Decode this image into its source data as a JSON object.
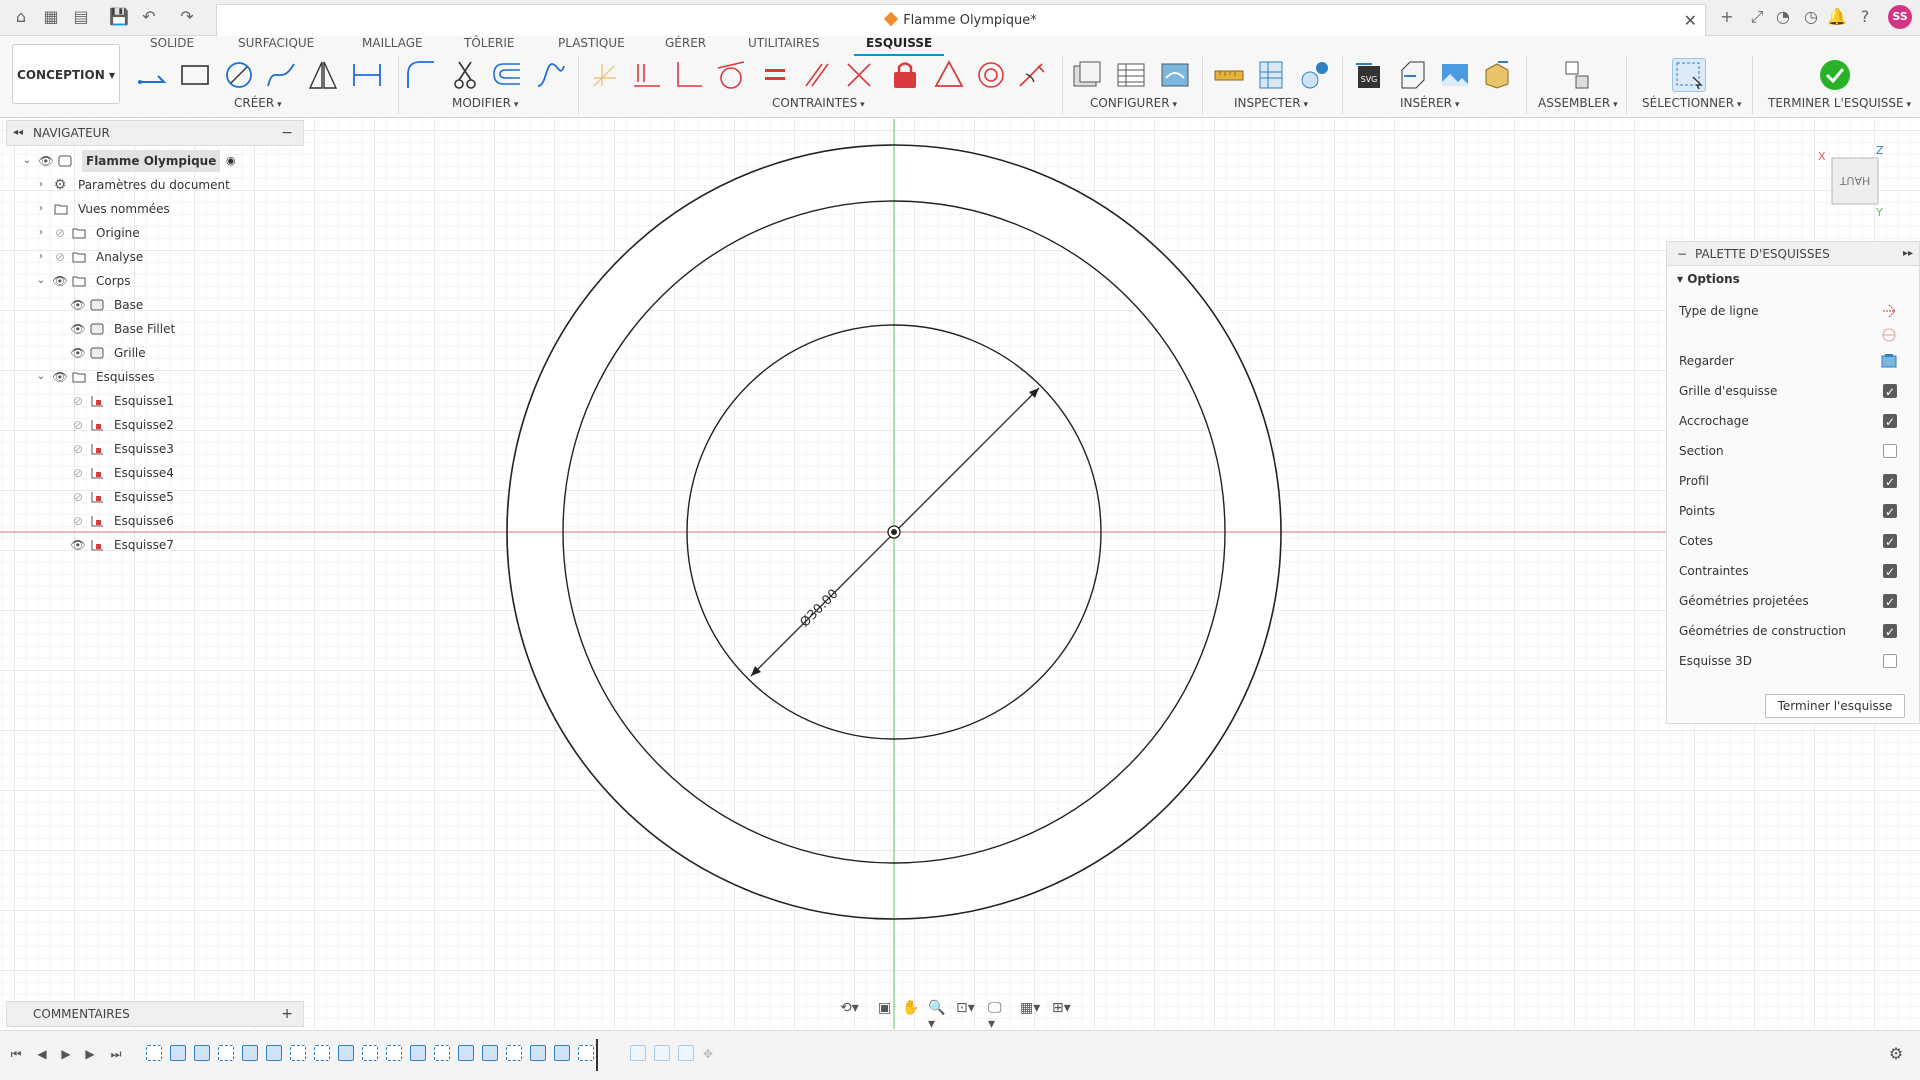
{
  "window": {
    "title": "Flamme Olympique*",
    "user_initials": "SS"
  },
  "ribbon": {
    "workspace": "CONCEPTION",
    "tabs": [
      "SOLIDE",
      "SURFACIQUE",
      "MAILLAGE",
      "TÔLERIE",
      "PLASTIQUE",
      "GÉRER",
      "UTILITAIRES",
      "ESQUISSE"
    ],
    "active_tab": "ESQUISSE",
    "groups": [
      "CRÉER",
      "MODIFIER",
      "CONTRAINTES",
      "CONFIGURER",
      "INSPECTER",
      "INSÉRER",
      "ASSEMBLER",
      "SÉLECTIONNER",
      "TERMINER L'ESQUISSE"
    ]
  },
  "navigator": {
    "title": "NAVIGATEUR",
    "items": [
      {
        "label": "Flamme Olympique",
        "icon": "component-icon",
        "visible": true
      },
      {
        "label": "Paramètres du document",
        "icon": "gear-icon"
      },
      {
        "label": "Vues nommées",
        "icon": "folder-icon"
      },
      {
        "label": "Origine",
        "icon": "folder-icon",
        "visible": false
      },
      {
        "label": "Analyse",
        "icon": "folder-icon",
        "visible": false
      },
      {
        "label": "Corps",
        "icon": "folder-icon",
        "visible": true
      },
      {
        "label": "Base",
        "icon": "body-icon",
        "visible": true
      },
      {
        "label": "Base Fillet",
        "icon": "body-icon",
        "visible": true
      },
      {
        "label": "Grille",
        "icon": "body-icon",
        "visible": true
      },
      {
        "label": "Esquisses",
        "icon": "folder-icon",
        "visible": true
      },
      {
        "label": "Esquisse1",
        "icon": "sketch-icon",
        "visible": false
      },
      {
        "label": "Esquisse2",
        "icon": "sketch-icon",
        "visible": false
      },
      {
        "label": "Esquisse3",
        "icon": "sketch-icon",
        "visible": false
      },
      {
        "label": "Esquisse4",
        "icon": "sketch-icon",
        "visible": false
      },
      {
        "label": "Esquisse5",
        "icon": "sketch-icon",
        "visible": false
      },
      {
        "label": "Esquisse6",
        "icon": "sketch-icon",
        "visible": false
      },
      {
        "label": "Esquisse7",
        "icon": "sketch-icon",
        "visible": true
      }
    ]
  },
  "canvas": {
    "dimension": "Ø30.00",
    "viewcube_label": "HAUT",
    "axis_x": "X",
    "axis_y": "Y",
    "axis_z": "Z"
  },
  "palette": {
    "title": "PALETTE D'ESQUISSES",
    "section": "Options",
    "rows": [
      {
        "label": "Type de ligne",
        "kind": "icon"
      },
      {
        "label": "Regarder",
        "kind": "icon"
      },
      {
        "label": "Grille d'esquisse",
        "checked": true
      },
      {
        "label": "Accrochage",
        "checked": true
      },
      {
        "label": "Section",
        "checked": false
      },
      {
        "label": "Profil",
        "checked": true
      },
      {
        "label": "Points",
        "checked": true
      },
      {
        "label": "Cotes",
        "checked": true
      },
      {
        "label": "Contraintes",
        "checked": true
      },
      {
        "label": "Géométries projetées",
        "checked": true
      },
      {
        "label": "Géométries de construction",
        "checked": true
      },
      {
        "label": "Esquisse 3D",
        "checked": false
      }
    ],
    "finish_button": "Terminer l'esquisse"
  },
  "comments": {
    "title": "COMMENTAIRES"
  },
  "colors": {
    "accent": "#0696d7",
    "x_axis": "#e05a5a",
    "y_axis": "#58c25a",
    "finish_green": "#27b227"
  }
}
